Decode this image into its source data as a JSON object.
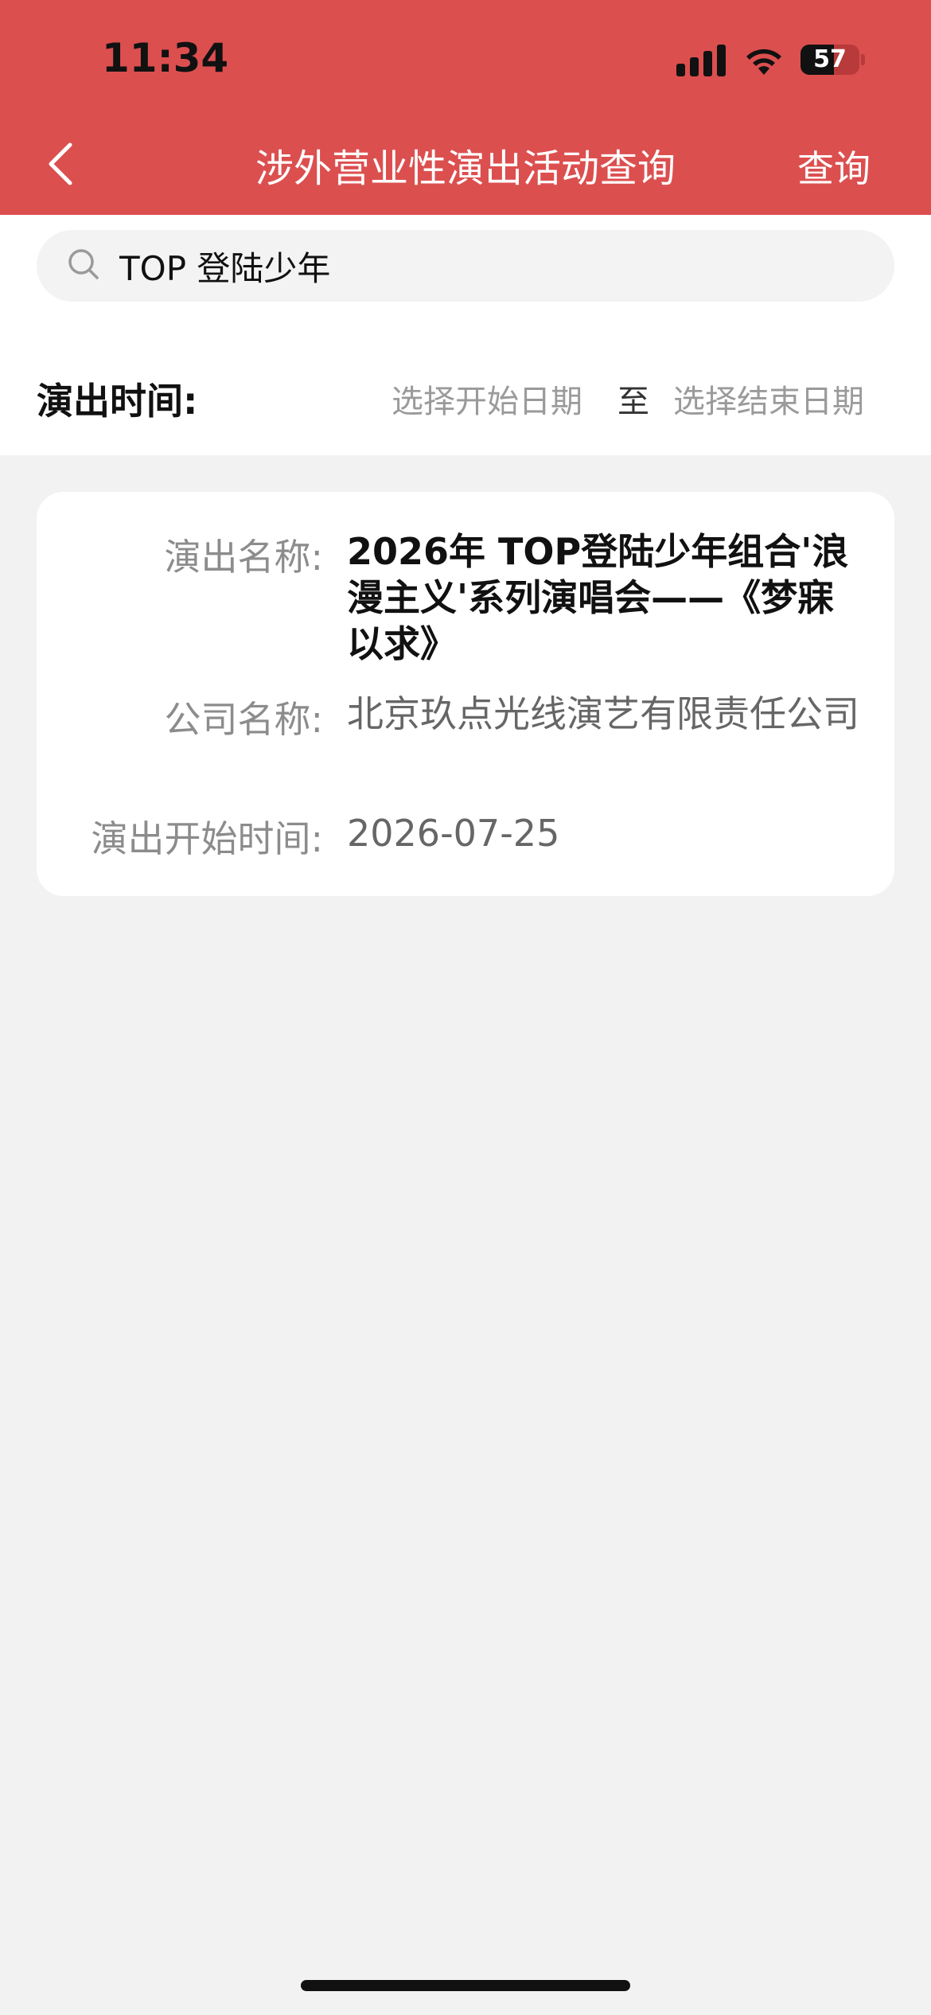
{
  "status_bar": {
    "time": "11:34",
    "battery": "57"
  },
  "nav": {
    "title": "涉外营业性演出活动查询",
    "query_label": "查询"
  },
  "search": {
    "value": "TOP 登陆少年"
  },
  "date_filter": {
    "label": "演出时间:",
    "start_placeholder": "选择开始日期",
    "separator": "至",
    "end_placeholder": "选择结束日期"
  },
  "result": {
    "show_name_label": "演出名称:",
    "show_name": "2026年 TOP登陆少年组合'浪漫主义'系列演唱会——《梦寐以求》",
    "company_label": "公司名称:",
    "company": "北京玖点光线演艺有限责任公司",
    "start_time_label": "演出开始时间:",
    "start_time": "2026-07-25"
  },
  "colors": {
    "header": "#dc4f4f",
    "background": "#f2f2f3"
  }
}
